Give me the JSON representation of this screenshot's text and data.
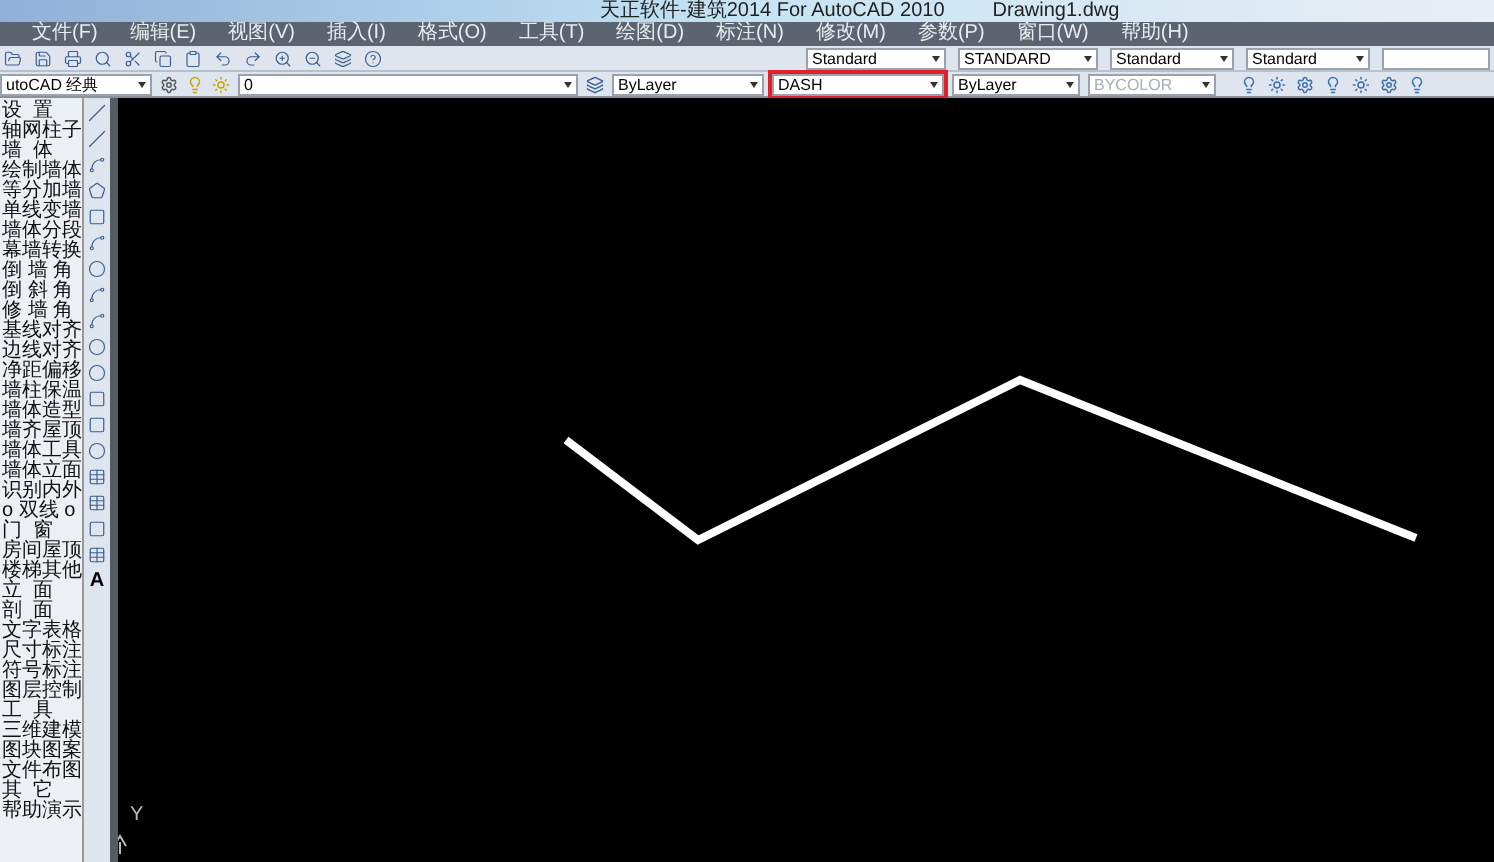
{
  "window": {
    "title": "天正软件-建筑2014 For AutoCAD 2010",
    "document": "Drawing1.dwg"
  },
  "menu": [
    "文件(F)",
    "编辑(E)",
    "视图(V)",
    "插入(I)",
    "格式(O)",
    "工具(T)",
    "绘图(D)",
    "标注(N)",
    "修改(M)",
    "参数(P)",
    "窗口(W)",
    "帮助(H)"
  ],
  "styles_toolbar": {
    "text_style": "Standard",
    "dim_style": "STANDARD",
    "table_style": "Standard",
    "multileader_style": "Standard"
  },
  "properties_toolbar": {
    "workspace": "utoCAD 经典",
    "layer": "0",
    "color_control": "ByLayer",
    "linetype": {
      "value": "DASH",
      "highlighted": true
    },
    "lineweight": "ByLayer",
    "plot_style": {
      "value": "BYCOLOR",
      "disabled": true
    }
  },
  "sidebar": {
    "items": [
      {
        "label": "设  置"
      },
      {
        "label": "轴网柱子"
      },
      {
        "label": "墙  体"
      },
      {
        "label": "绘制墙体"
      },
      {
        "label": "等分加墙"
      },
      {
        "label": "单线变墙"
      },
      {
        "label": "墙体分段"
      },
      {
        "label": "幕墙转换"
      },
      {
        "label": "倒 墙 角"
      },
      {
        "label": "倒 斜 角"
      },
      {
        "label": "修 墙 角"
      },
      {
        "label": "基线对齐"
      },
      {
        "label": "边线对齐"
      },
      {
        "label": "净距偏移"
      },
      {
        "label": "墙柱保温"
      },
      {
        "label": "墙体造型"
      },
      {
        "label": "墙齐屋顶"
      },
      {
        "label": "墙体工具"
      },
      {
        "label": "墙体立面"
      },
      {
        "label": "识别内外"
      },
      {
        "label": "o 双线 o"
      },
      {
        "label": "门  窗"
      },
      {
        "label": "房间屋顶"
      },
      {
        "label": "楼梯其他"
      },
      {
        "label": "立  面"
      },
      {
        "label": "剖  面"
      },
      {
        "label": "文字表格"
      },
      {
        "label": "尺寸标注"
      },
      {
        "label": "符号标注"
      },
      {
        "label": "图层控制"
      },
      {
        "label": "工  具"
      },
      {
        "label": "三维建模"
      },
      {
        "label": "图块图案"
      },
      {
        "label": "文件布图"
      },
      {
        "label": "其  它"
      },
      {
        "label": "帮助演示"
      }
    ]
  },
  "draw_toolbar": {
    "text_tool": "A"
  },
  "canvas": {
    "ucs_label": "Y"
  }
}
